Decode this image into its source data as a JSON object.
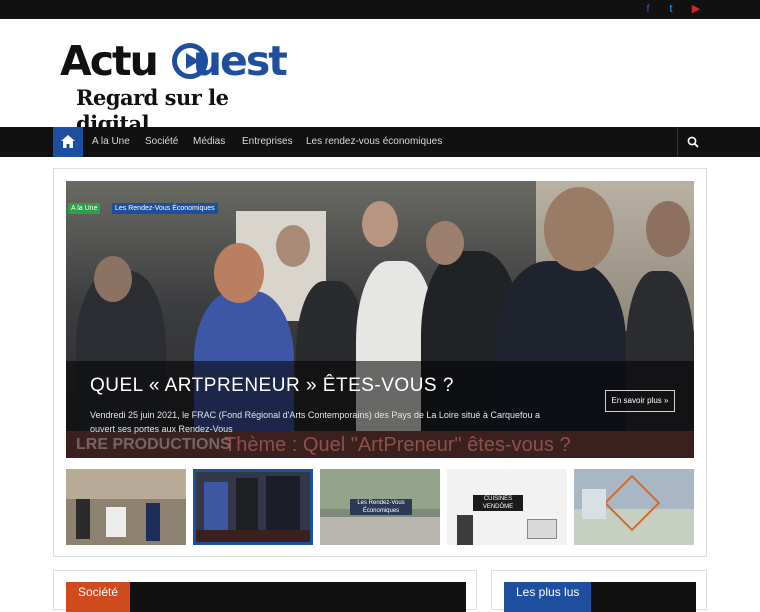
{
  "topbar": {
    "social": [
      {
        "name": "facebook",
        "glyph": "f",
        "color": "#3b5998"
      },
      {
        "name": "twitter",
        "glyph": "t",
        "color": "#1da1f2"
      },
      {
        "name": "youtube",
        "glyph": "▶",
        "color": "#cc2a2a"
      }
    ]
  },
  "header": {
    "logo_part1": "Actu",
    "logo_part2": "uest",
    "tagline": "Regard sur le digital"
  },
  "nav": {
    "items": [
      "A la Une",
      "Société",
      "Médias",
      "Entreprises",
      "Les rendez-vous économiques"
    ],
    "active_color": "#1d4f9e"
  },
  "hero": {
    "tags": [
      {
        "label": "A la Une",
        "color": "#2e9f45"
      },
      {
        "label": "Les Rendez-Vous Économiques",
        "color": "#1d4f9e"
      }
    ],
    "title": "QUEL « ARTPRENEUR » ÊTES-VOUS ?",
    "excerpt": "Vendredi 25 juin 2021, le FRAC (Fond Régional d'Arts Contemporains) des Pays de La Loire situé à Carquefou a ouvert ses portes aux Rendez-Vous",
    "more_label": "En savoir plus »",
    "banner_text": "Thème : Quel \"ArtPreneur\" êtes-vous ?",
    "banner_brand": "LRE PRODUCTIONS"
  },
  "thumbnails": [
    {
      "name": "thumb-event-room",
      "bg": "#8d8170"
    },
    {
      "name": "thumb-artpreneur",
      "bg": "#34364a"
    },
    {
      "name": "thumb-rendez-vous",
      "bg": "#7e8b7c",
      "text": "Les Rendez-Vous Économiques"
    },
    {
      "name": "thumb-cuisines",
      "bg": "#9a9a98",
      "text": "CUISINES VENDÔME"
    },
    {
      "name": "thumb-building",
      "bg": "#a9b7c4"
    }
  ],
  "sections": {
    "left_label": "Société",
    "left_color": "#cf4a1d",
    "right_label": "Les plus lus",
    "right_color": "#1d4f9e"
  }
}
